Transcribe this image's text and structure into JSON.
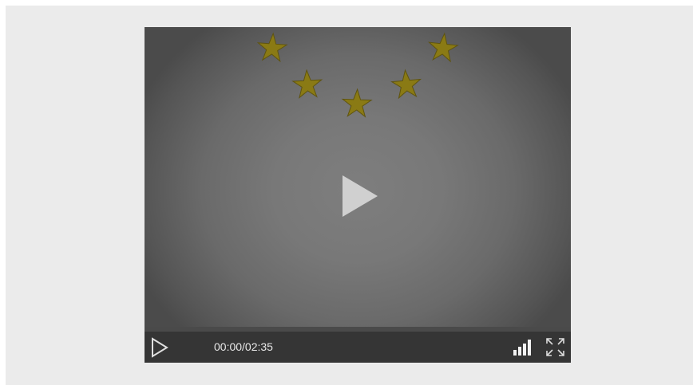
{
  "player": {
    "time_display": "00:00/02:35",
    "progress": 0,
    "state": "paused",
    "icons": {
      "center_play": "play-icon",
      "control_play": "play-icon",
      "quality": "signal-bars-icon",
      "fullscreen": "fullscreen-icon"
    },
    "colors": {
      "page_background": "#ebebeb",
      "control_bar": "#353535",
      "time_text": "#e8e8e8",
      "star": "#8a7a14"
    }
  }
}
